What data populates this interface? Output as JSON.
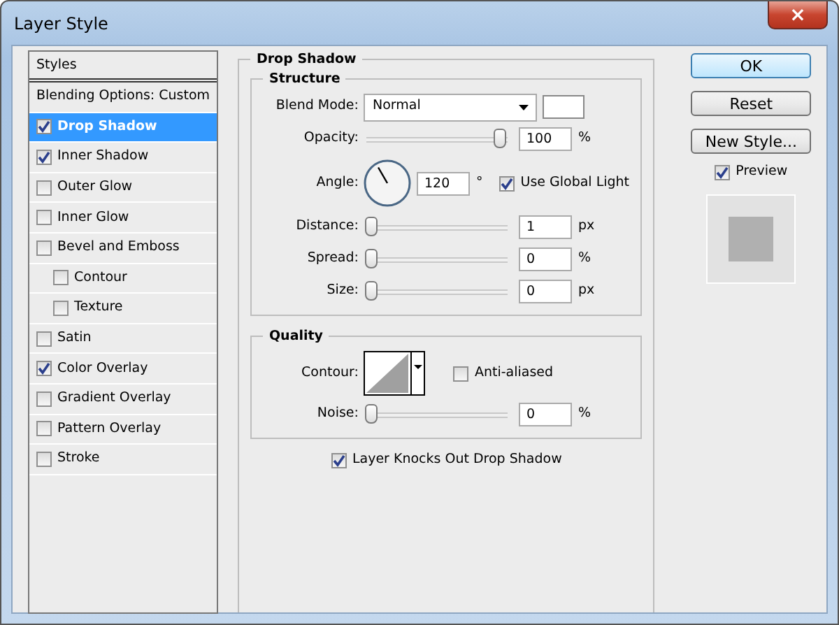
{
  "window": {
    "title": "Layer Style",
    "close": "×"
  },
  "styles_panel": {
    "header": "Styles",
    "items": [
      {
        "label": "Blending Options: Custom",
        "kind": "plain",
        "selected": false
      },
      {
        "label": "Drop Shadow",
        "kind": "check",
        "checked": true,
        "selected": true
      },
      {
        "label": "Inner Shadow",
        "kind": "check",
        "checked": true,
        "selected": false
      },
      {
        "label": "Outer Glow",
        "kind": "check",
        "checked": false,
        "selected": false
      },
      {
        "label": "Inner Glow",
        "kind": "check",
        "checked": false,
        "selected": false
      },
      {
        "label": "Bevel and Emboss",
        "kind": "check",
        "checked": false,
        "selected": false,
        "children": [
          {
            "label": "Contour",
            "kind": "check",
            "checked": false,
            "selected": false
          },
          {
            "label": "Texture",
            "kind": "check",
            "checked": false,
            "selected": false
          }
        ]
      },
      {
        "label": "Satin",
        "kind": "check",
        "checked": false,
        "selected": false
      },
      {
        "label": "Color Overlay",
        "kind": "check",
        "checked": true,
        "selected": false
      },
      {
        "label": "Gradient Overlay",
        "kind": "check",
        "checked": false,
        "selected": false
      },
      {
        "label": "Pattern Overlay",
        "kind": "check",
        "checked": false,
        "selected": false
      },
      {
        "label": "Stroke",
        "kind": "check",
        "checked": false,
        "selected": false
      }
    ]
  },
  "drop_shadow": {
    "title": "Drop Shadow",
    "structure": {
      "title": "Structure",
      "blend_mode": {
        "label": "Blend Mode:",
        "value": "Normal",
        "color": "#ffffff"
      },
      "opacity": {
        "label": "Opacity:",
        "level": 1,
        "value": "100",
        "unit": "%"
      },
      "angle": {
        "label": "Angle:",
        "value": "120",
        "unit": "°",
        "global_light": {
          "label": "Use Global Light",
          "checked": true
        }
      },
      "sliders": [
        {
          "label": "Distance:",
          "level": 0,
          "value": "1",
          "unit": "px"
        },
        {
          "label": "Spread:",
          "level": 0,
          "value": "0",
          "unit": "%"
        },
        {
          "label": "Size:",
          "level": 0,
          "value": "0",
          "unit": "px"
        }
      ]
    },
    "quality": {
      "title": "Quality",
      "contour": {
        "label": "Contour:",
        "anti_aliased": {
          "label": "Anti-aliased",
          "checked": false
        }
      },
      "noise": {
        "label": "Noise:",
        "level": 0,
        "value": "0",
        "unit": "%"
      }
    },
    "knockout": {
      "label": "Layer Knocks Out Drop Shadow",
      "checked": true
    }
  },
  "buttons": [
    {
      "label": "OK",
      "default": true
    },
    {
      "label": "Reset",
      "default": false
    },
    {
      "label": "New Style...",
      "default": false
    }
  ],
  "preview": {
    "label": "Preview",
    "checked": true
  }
}
